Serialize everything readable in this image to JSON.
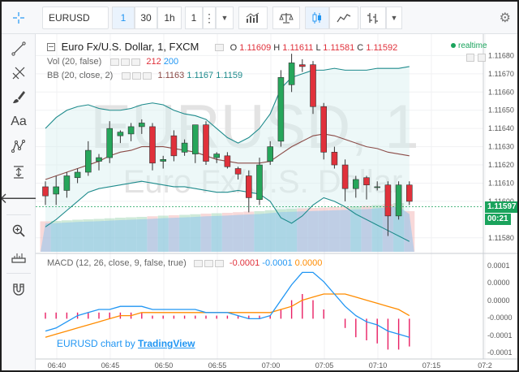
{
  "toolbar": {
    "symbol": "EURUSD",
    "intervals": [
      "1",
      "30",
      "1h",
      "1"
    ],
    "active_interval_index": 0
  },
  "chart": {
    "watermark": "EURUSD, 1",
    "watermark_sub": "Euro Fx/U.S. Dollar",
    "title": "Euro Fx/U.S. Dollar, 1, FXCM",
    "ohlc": {
      "o_label": "O",
      "o": "1.11609",
      "h_label": "H",
      "h": "1.11611",
      "l_label": "L",
      "l": "1.11581",
      "c_label": "C",
      "c": "1.11592"
    },
    "realtime": "realtime",
    "vol_legend": {
      "label": "Vol (20, false)",
      "v1": "212",
      "v2": "200"
    },
    "bb_legend": {
      "label": "BB (20, close, 2)",
      "v1": "1.1163",
      "v2": "1.1167",
      "v3": "1.1159"
    },
    "macd_legend": {
      "label": "MACD (12, 26, close, 9, false, true)",
      "v1": "-0.0001",
      "v2": "-0.0001",
      "v3": "0.0000"
    },
    "credit_prefix": "EURUSD chart by",
    "credit_link": "TradingView",
    "price_axis": [
      "1.11680",
      "1.11670",
      "1.11660",
      "1.11650",
      "1.11640",
      "1.11630",
      "1.11620",
      "1.11610",
      "1.11600",
      "1.11580"
    ],
    "current_price": "1.11597",
    "countdown": "00:21",
    "macd_axis": [
      "0.0001",
      "0.0000",
      "0.0000",
      "-0.0000",
      "-0.0001",
      "-0.0001"
    ],
    "time_axis": [
      "06:40",
      "06:45",
      "06:50",
      "06:55",
      "07:00",
      "07:05",
      "07:10",
      "07:15",
      "07:2"
    ],
    "colors": {
      "up": "#26a65b",
      "down": "#e0313b",
      "bb_band": "#1e8b8c",
      "bb_basis": "#8b4b47",
      "macd_line": "#2196f3",
      "signal_line": "#ff8c00",
      "hist": "#e91e63"
    }
  },
  "chart_data": {
    "type": "candlestick",
    "symbol": "EURUSD",
    "interval": "1",
    "candles_o_h_l_c": [
      [
        1.11608,
        1.11611,
        1.11598,
        1.11603
      ],
      [
        1.11604,
        1.11614,
        1.11598,
        1.11608
      ],
      [
        1.11606,
        1.11616,
        1.11602,
        1.11614
      ],
      [
        1.11613,
        1.11618,
        1.1161,
        1.11616
      ],
      [
        1.11616,
        1.11633,
        1.11614,
        1.11628
      ],
      [
        1.11622,
        1.11626,
        1.11617,
        1.11624
      ],
      [
        1.11624,
        1.11644,
        1.11621,
        1.1164
      ],
      [
        1.11636,
        1.11639,
        1.11632,
        1.11638
      ],
      [
        1.11637,
        1.11643,
        1.11633,
        1.11641
      ],
      [
        1.11641,
        1.11645,
        1.11637,
        1.11643
      ],
      [
        1.11641,
        1.11643,
        1.11617,
        1.11621
      ],
      [
        1.11622,
        1.11625,
        1.11618,
        1.11623
      ],
      [
        1.11636,
        1.11639,
        1.11622,
        1.11625
      ],
      [
        1.11627,
        1.11634,
        1.11625,
        1.11632
      ],
      [
        1.11626,
        1.11642,
        1.11621,
        1.11642
      ],
      [
        1.11642,
        1.11644,
        1.1162,
        1.11622
      ],
      [
        1.11624,
        1.11627,
        1.11621,
        1.11626
      ],
      [
        1.11625,
        1.11627,
        1.11618,
        1.11619
      ],
      [
        1.11618,
        1.11619,
        1.11612,
        1.11615
      ],
      [
        1.11614,
        1.11617,
        1.11594,
        1.11602
      ],
      [
        1.11601,
        1.11624,
        1.11598,
        1.1162
      ],
      [
        1.11622,
        1.11633,
        1.1162,
        1.1163
      ],
      [
        1.11633,
        1.11672,
        1.1163,
        1.11668
      ],
      [
        1.11664,
        1.11681,
        1.1166,
        1.11676
      ],
      [
        1.11675,
        1.11678,
        1.11671,
        1.11674
      ],
      [
        1.11675,
        1.11677,
        1.11648,
        1.11652
      ],
      [
        1.11652,
        1.11654,
        1.11623,
        1.11627
      ],
      [
        1.11627,
        1.1163,
        1.11618,
        1.1162
      ],
      [
        1.1162,
        1.11623,
        1.116,
        1.11607
      ],
      [
        1.11607,
        1.11614,
        1.11602,
        1.11612
      ],
      [
        1.11613,
        1.11614,
        1.11601,
        1.11609
      ],
      [
        1.11608,
        1.11611,
        1.11606,
        1.11608
      ],
      [
        1.11609,
        1.11611,
        1.11581,
        1.11592
      ],
      [
        1.11592,
        1.11611,
        1.1159,
        1.11609
      ],
      [
        1.11609,
        1.11611,
        1.11598,
        1.116
      ]
    ],
    "bb_upper": [
      1.1164,
      1.11646,
      1.1165,
      1.11652,
      1.11653,
      1.11651,
      1.1165,
      1.1165,
      1.11651,
      1.11653,
      1.11654,
      1.11653,
      1.1165,
      1.11648,
      1.11647,
      1.11645,
      1.1164,
      1.11635,
      1.11632,
      1.11635,
      1.1164,
      1.11648,
      1.11662,
      1.11668,
      1.1167,
      1.11672,
      1.11672,
      1.11673,
      1.11672,
      1.11672,
      1.11672,
      1.11673,
      1.11673,
      1.11673,
      1.11674
    ],
    "bb_basis": [
      1.11612,
      1.11614,
      1.11616,
      1.11618,
      1.1162,
      1.11622,
      1.11625,
      1.11627,
      1.11628,
      1.1163,
      1.1163,
      1.1163,
      1.11629,
      1.11628,
      1.11627,
      1.11625,
      1.11623,
      1.11622,
      1.11621,
      1.11621,
      1.11621,
      1.11622,
      1.11626,
      1.1163,
      1.11633,
      1.11636,
      1.11637,
      1.11636,
      1.11634,
      1.11632,
      1.1163,
      1.11629,
      1.11627,
      1.11626,
      1.11625
    ],
    "bb_lower": [
      1.11586,
      1.1159,
      1.11595,
      1.116,
      1.11605,
      1.11607,
      1.11608,
      1.11609,
      1.1161,
      1.11611,
      1.1161,
      1.11609,
      1.11608,
      1.11608,
      1.11607,
      1.11606,
      1.11605,
      1.11605,
      1.11606,
      1.11605,
      1.11604,
      1.116,
      1.11591,
      1.11588,
      1.11592,
      1.11598,
      1.11602,
      1.116,
      1.11597,
      1.11593,
      1.1159,
      1.11587,
      1.11584,
      1.11581,
      1.11578
    ],
    "volume": [
      150,
      152,
      155,
      158,
      160,
      162,
      165,
      168,
      170,
      172,
      175,
      178,
      180,
      182,
      185,
      188,
      190,
      192,
      195,
      198,
      200,
      205,
      210,
      212,
      214,
      216,
      218,
      220,
      222,
      224,
      226,
      230,
      235,
      240,
      200
    ],
    "macd": [
      -4e-05,
      -3e-05,
      -1e-05,
      1e-05,
      2e-05,
      3e-05,
      3e-05,
      4e-05,
      4e-05,
      4e-05,
      3e-05,
      3e-05,
      3e-05,
      3e-05,
      3e-05,
      2e-05,
      2e-05,
      2e-05,
      1e-05,
      0.0,
      0.0,
      1e-05,
      6e-05,
      0.00011,
      0.00015,
      0.00015,
      0.00012,
      8e-05,
      4e-05,
      1e-05,
      -1e-05,
      -2e-05,
      -4e-05,
      -5e-05,
      -6e-05
    ],
    "signal": [
      -6e-05,
      -5e-05,
      -4e-05,
      -3e-05,
      -2e-05,
      -1e-05,
      0.0,
      1e-05,
      1e-05,
      2e-05,
      2e-05,
      2e-05,
      2e-05,
      2e-05,
      2e-05,
      2e-05,
      2e-05,
      2e-05,
      2e-05,
      2e-05,
      2e-05,
      2e-05,
      3e-05,
      4e-05,
      6e-05,
      7e-05,
      8e-05,
      8e-05,
      8e-05,
      7e-05,
      6e-05,
      5e-05,
      4e-05,
      3e-05,
      1e-05
    ],
    "histogram": [
      2e-05,
      2e-05,
      2e-05,
      2e-05,
      2e-05,
      2e-05,
      2e-05,
      2e-05,
      2e-05,
      2e-05,
      1e-05,
      1e-05,
      1e-05,
      1e-05,
      1e-05,
      1e-05,
      1e-05,
      1e-05,
      1e-05,
      1e-05,
      1e-05,
      1e-05,
      3e-05,
      6e-05,
      8e-05,
      6e-05,
      3e-05,
      0.0,
      -3e-05,
      -6e-05,
      -7e-05,
      -8e-05,
      -0.0001,
      -0.0001,
      -9e-05
    ],
    "current_price": 1.11597,
    "ylim": [
      1.11575,
      1.1169
    ]
  }
}
